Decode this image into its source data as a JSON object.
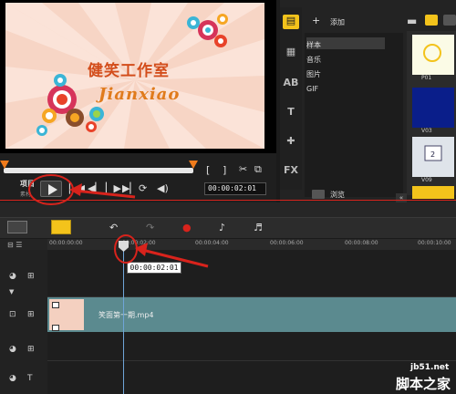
{
  "preview": {
    "title_main": "健笑工作室",
    "title_sub": "Jianxiao",
    "project_label": "项目",
    "clip_label": "素材",
    "timecode": "00:00:02:01"
  },
  "library": {
    "add_label": "添加",
    "items": [
      "样本",
      "音乐",
      "图片",
      "GIF"
    ],
    "browse_label": "浏览",
    "thumb_labels": [
      "P01",
      "V03",
      "V09"
    ]
  },
  "timeline": {
    "ticks": [
      "00:00:00:00",
      "00:00:02:00",
      "00:00:04:00",
      "00:00:06:00",
      "00:00:08:00",
      "00:00:10:00"
    ],
    "playhead_time": "00:00:02:01",
    "clip_name": "笑面第一期.mp4"
  },
  "watermark": {
    "line1": "jb51.net",
    "line2": "脚本之家"
  },
  "colors": {
    "annotation": "#d8231c",
    "clip": "#5b8a8f",
    "scrub_handle": "#f07b1b",
    "accent_yellow": "#f3c31b"
  }
}
